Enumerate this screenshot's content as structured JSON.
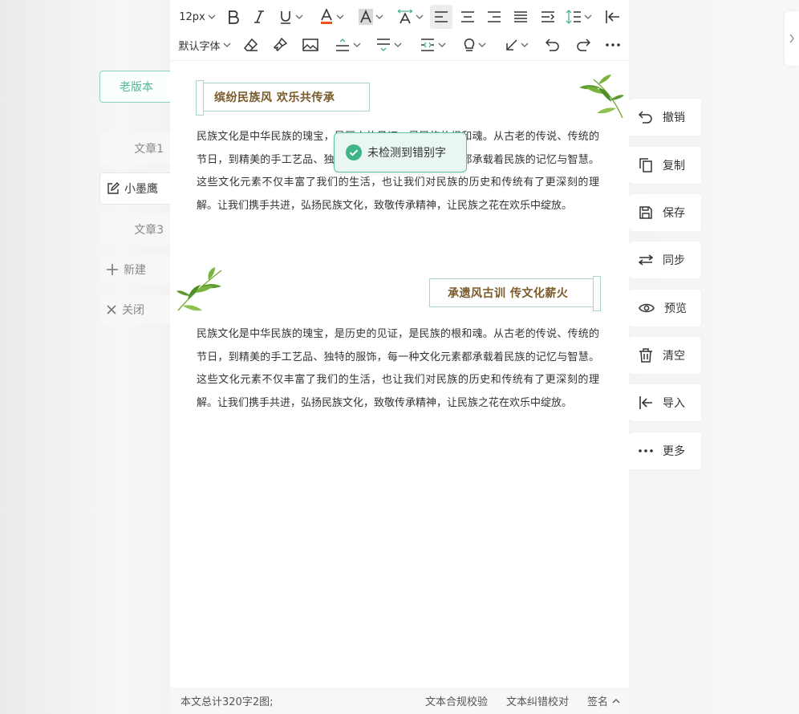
{
  "left_panel": {
    "old_version": "老版本",
    "docs": [
      {
        "label": "文章1",
        "active": false
      },
      {
        "label": "小墨鹰",
        "active": true
      },
      {
        "label": "文章3",
        "active": false
      }
    ],
    "new_label": "新建",
    "close_label": "关闭"
  },
  "toolbar": {
    "font_size": "12px",
    "font_family": "默认字体"
  },
  "content": {
    "title1": "缤纷民族风 欢乐共传承",
    "para1": "民族文化是中华民族的瑰宝，是历史的见证，是民族的根和魂。从古老的传说、传统的节日，到精美的手工艺品、独特的服饰，每一种文化元素都承载着民族的记忆与智慧。这些文化元素不仅丰富了我们的生活，也让我们对民族的历史和传统有了更深刻的理解。让我们携手共进，弘扬民族文化，致敬传承精神，让民族之花在欢乐中绽放。",
    "title2": "承遗风古训 传文化薪火",
    "para2": "民族文化是中华民族的瑰宝，是历史的见证，是民族的根和魂。从古老的传说、传统的节日，到精美的手工艺品、独特的服饰，每一种文化元素都承载着民族的记忆与智慧。这些文化元素不仅丰富了我们的生活，也让我们对民族的历史和传统有了更深刻的理解。让我们携手共进，弘扬民族文化，致敬传承精神，让民族之花在欢乐中绽放。",
    "toast": "未检测到错别字"
  },
  "status_bar": {
    "count": "本文总计320字2图;",
    "compliance": "文本合规校验",
    "proofread": "文本纠错校对",
    "signature": "签名"
  },
  "right_panel": {
    "undo": "撤销",
    "copy": "复制",
    "save": "保存",
    "sync": "同步",
    "preview": "预览",
    "clear": "清空",
    "import": "导入",
    "more": "更多"
  },
  "colors": {
    "accent": "#52b894",
    "title_text": "#7a5a2a",
    "font_color_bar": "#e8541c"
  }
}
